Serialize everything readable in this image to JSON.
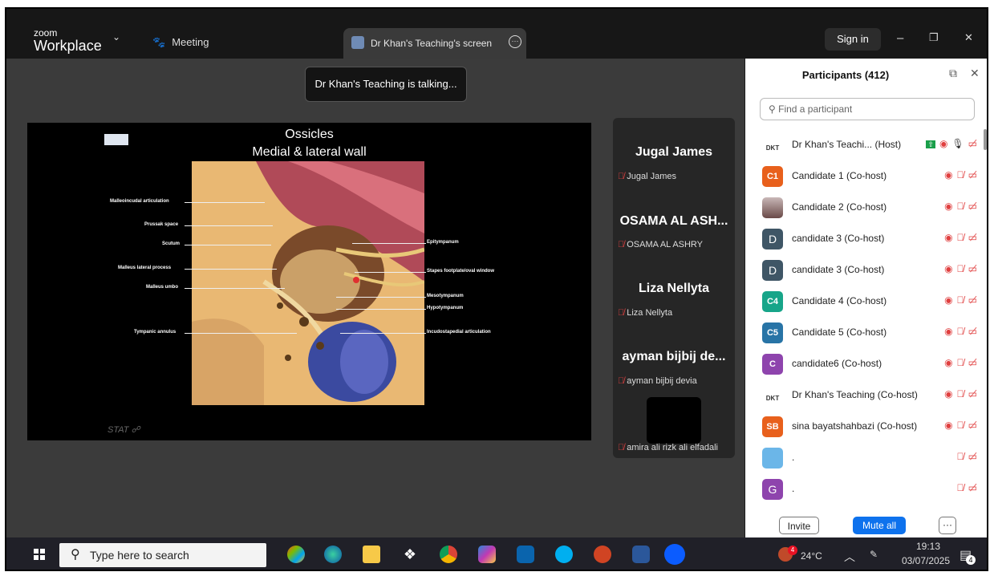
{
  "titlebar": {
    "brand_small": "zoom",
    "brand_big": "Workplace",
    "meeting_label": "Meeting",
    "tab_label": "Dr Khan's Teaching's screen",
    "signin_label": "Sign in",
    "minimize": "–",
    "restore": "❐",
    "close": "✕"
  },
  "stage": {
    "talking_banner": "Dr Khan's Teaching is talking...",
    "slide": {
      "title_line1": "Ossicles",
      "title_line2": "Medial & lateral wall",
      "watermark": "STAT ☍",
      "labels_left": [
        "Malleoincudal articulation",
        "Prussak space",
        "Scutum",
        "Malleus lateral process",
        "Malleus umbo",
        "Tympanic annulus"
      ],
      "labels_right": [
        "Epitympanum",
        "Stapes footplate/oval window",
        "Mesotympanum",
        "Hypotympanum",
        "Incudostapedial articulation"
      ]
    }
  },
  "thumbnails": [
    {
      "big": "Jugal James",
      "small": "Jugal James"
    },
    {
      "big": "OSAMA AL ASH...",
      "small": "OSAMA AL ASHRY"
    },
    {
      "big": "Liza Nellyta",
      "small": "Liza Nellyta"
    },
    {
      "big": "ayman bijbij de...",
      "small": "ayman bijbij devia"
    },
    {
      "big": "",
      "small": "amira ali rizk ali elfadali"
    }
  ],
  "panel": {
    "title": "Participants (412)",
    "search_placeholder": "Find a participant",
    "participants": [
      {
        "initials": "DKT",
        "name": "Dr Khan's Teachi... (Host)",
        "color": "#ffffff"
      },
      {
        "initials": "C1",
        "name": "Candidate 1 (Co-host)",
        "color": "#e8601c"
      },
      {
        "initials": "",
        "name": "Candidate 2 (Co-host)",
        "color": "#8a6e6a"
      },
      {
        "initials": "D",
        "name": "candidate 3 (Co-host)",
        "color": "#3f5666"
      },
      {
        "initials": "D",
        "name": "candidate 3 (Co-host)",
        "color": "#3f5666"
      },
      {
        "initials": "C4",
        "name": "Candidate 4 (Co-host)",
        "color": "#17a589"
      },
      {
        "initials": "C5",
        "name": "Candidate 5 (Co-host)",
        "color": "#2874a6"
      },
      {
        "initials": "C",
        "name": "candidate6 (Co-host)",
        "color": "#8e44ad"
      },
      {
        "initials": "DKT",
        "name": "Dr Khan's Teaching (Co-host)",
        "color": "#ffffff"
      },
      {
        "initials": "SB",
        "name": "sina bayatshahbazi (Co-host)",
        "color": "#e8601c"
      },
      {
        "initials": "",
        "name": ".",
        "color": "#6bb6e8"
      },
      {
        "initials": "G",
        "name": ".",
        "color": "#8e44ad"
      }
    ],
    "invite_label": "Invite",
    "mute_all_label": "Mute all",
    "more_label": "···"
  },
  "taskbar": {
    "search_placeholder": "Type here to search",
    "weather": "24°C",
    "time": "19:13",
    "date": "03/07/2025",
    "notif_count": "4",
    "weather_badge": "4"
  }
}
